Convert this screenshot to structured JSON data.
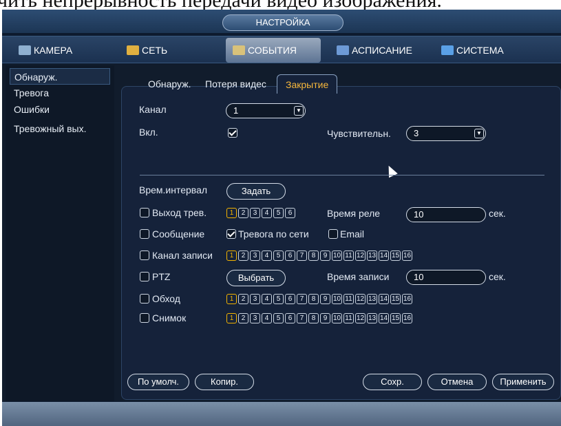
{
  "doc_caption": "чить непрерывность передачи видео изображения.",
  "window": {
    "title": "НАСТРОЙКА"
  },
  "topnav": [
    {
      "label": "КАМЕРА",
      "icon": "camera-icon"
    },
    {
      "label": "СЕТЬ",
      "icon": "network-icon"
    },
    {
      "label": "СОБЫТИЯ",
      "icon": "events-icon",
      "active": true
    },
    {
      "label": "АСПИСАНИЕ",
      "icon": "schedule-icon"
    },
    {
      "label": "СИСТЕМА",
      "icon": "system-icon"
    }
  ],
  "sidebar": [
    {
      "label": "Обнаруж.",
      "active": true
    },
    {
      "label": "Тревога"
    },
    {
      "label": "Ошибки"
    },
    {
      "label": "Тревожный вых."
    }
  ],
  "subtabs": [
    {
      "label": "Обнаруж."
    },
    {
      "label": "Потеря видес"
    },
    {
      "label": "Закрытие",
      "active": true
    }
  ],
  "form": {
    "channel_label": "Канал",
    "channel_value": "1",
    "enable_label": "Вкл.",
    "enable_checked": true,
    "sensitivity_label": "Чувствительн.",
    "sensitivity_value": "3",
    "period_label": "Врем.интервал",
    "period_button": "Задать",
    "alarm_out_label": "Выход трев.",
    "alarm_out_numbers": [
      "1",
      "2",
      "3",
      "4",
      "5",
      "6"
    ],
    "relay_label": "Время реле",
    "relay_value": "10",
    "relay_unit": "сек.",
    "message_label": "Сообщение",
    "net_alarm_label": "Тревога по сети",
    "net_alarm_checked": true,
    "email_label": "Email",
    "record_channel_label": "Канал записи",
    "channel_numbers": [
      "1",
      "2",
      "3",
      "4",
      "5",
      "6",
      "7",
      "8",
      "9",
      "10",
      "11",
      "12",
      "13",
      "14",
      "15",
      "16"
    ],
    "ptz_label": "PTZ",
    "ptz_button": "Выбрать",
    "record_time_label": "Время записи",
    "record_time_value": "10",
    "record_time_unit": "сек.",
    "tour_label": "Обход",
    "snapshot_label": "Снимок"
  },
  "buttons": {
    "default": "По умолч.",
    "copy": "Копир.",
    "save": "Сохр.",
    "cancel": "Отмена",
    "apply": "Применить"
  },
  "colors": {
    "accent": "#f4b400",
    "background": "#111c2c",
    "nav": "#1b3150"
  }
}
